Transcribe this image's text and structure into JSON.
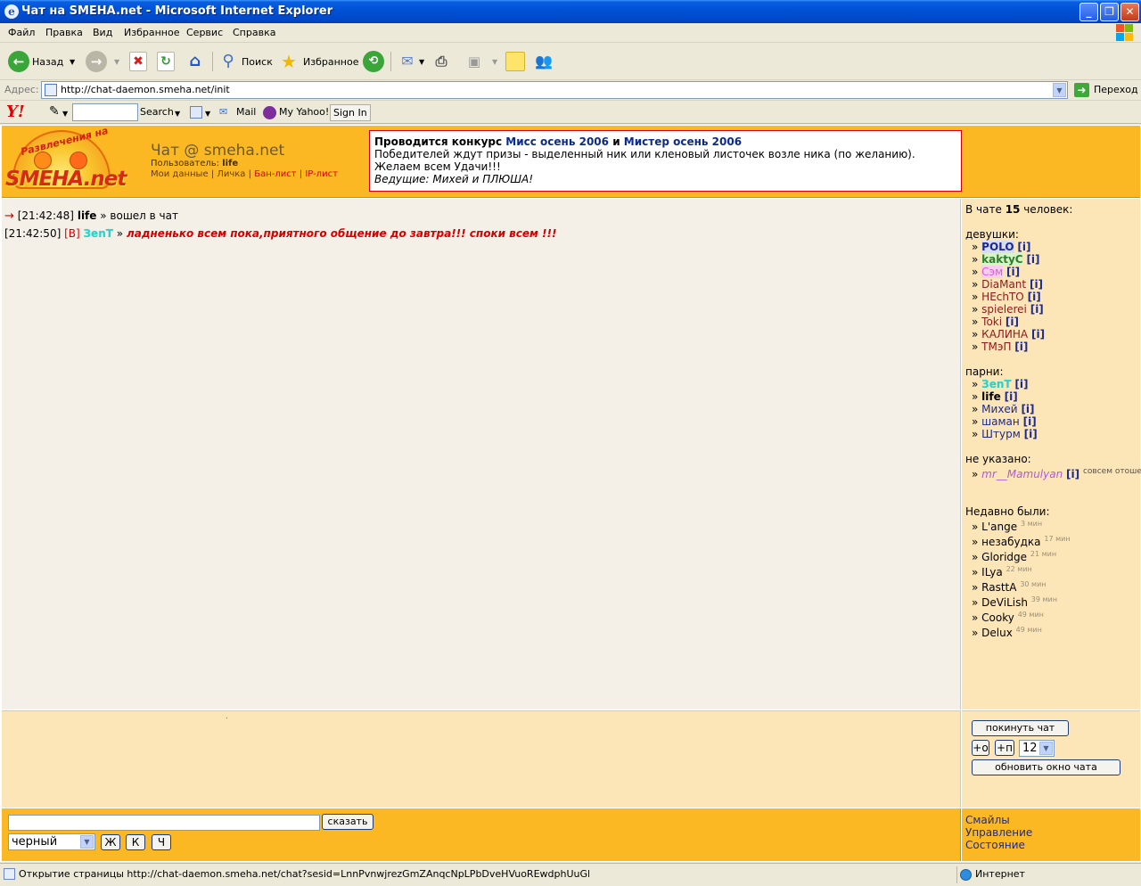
{
  "window": {
    "title": "Чат на SMEHA.net - Microsoft Internet Explorer"
  },
  "menu": [
    "Файл",
    "Правка",
    "Вид",
    "Избранное",
    "Сервис",
    "Справка"
  ],
  "toolbar": {
    "back": "Назад",
    "search": "Поиск",
    "favorites": "Избранное"
  },
  "address": {
    "label": "Адрес:",
    "url": "http://chat-daemon.smeha.net/init",
    "go": "Переход"
  },
  "yahoo": {
    "logo": "Y!",
    "search": "Search",
    "mail": "Mail",
    "my_yahoo": "My Yahoo!",
    "sign_in": "Sign In"
  },
  "header": {
    "logo_arc": "Развлечения на",
    "logo_main": "SMEHA.net",
    "chat_title": "Чат @ smeha.net",
    "user_label": "Пользователь:",
    "user_name": "life",
    "links": [
      "Мои данные",
      "Личка",
      "Бан-лист",
      "IP-лист"
    ]
  },
  "announcement": {
    "line1_a": "Проводится конкурс ",
    "line1_b": "Мисс осень 2006",
    "line1_c": " и ",
    "line1_d": "Мистер осень 2006",
    "line2": "Победителей ждут призы - выделенный ник или кленовый листочек возле ника (по желанию).",
    "line3": "Желаем всем Удачи!!!",
    "line4": "Ведущие: Михей и ПЛЮША!"
  },
  "messages": [
    {
      "arrow": "→",
      "time": "[21:42:48]",
      "nick": "life",
      "text": "» вошел в чат"
    },
    {
      "time": "[21:42:50]",
      "tag": "[В]",
      "nick": "ЗenT",
      "sep": "»",
      "text": "ладненько всем пока,приятного общение до завтра!!! споки всем !!!"
    }
  ],
  "sidebar": {
    "count_pre": "В чате ",
    "count": "15",
    "count_post": " человек:",
    "girls_label": "девушки:",
    "girls": [
      "POLO",
      "kaktyC",
      "Сэм",
      "DiaMant",
      "HEchTO",
      "spielerei",
      "Toki",
      "КАЛИНА",
      "ТМэП"
    ],
    "boys_label": "парни:",
    "boys": [
      "ЗenT",
      "life",
      "Михей",
      "шаман",
      "Штурм"
    ],
    "unspecified_label": "не указано:",
    "unspecified": [
      {
        "nick": "mr__Mamulyan",
        "status": "совсем отошел"
      }
    ],
    "info": "[i]",
    "bullet": "»",
    "recent_label": "Недавно были:",
    "recent": [
      {
        "nick": "L'ange",
        "ago": "3 мин"
      },
      {
        "nick": "незабудка",
        "ago": "17 мин"
      },
      {
        "nick": "Gloridge",
        "ago": "21 мин"
      },
      {
        "nick": "ILya",
        "ago": "22 мин"
      },
      {
        "nick": "RasttA",
        "ago": "30 мин"
      },
      {
        "nick": "DeViLish",
        "ago": "39 мин"
      },
      {
        "nick": "Cooky",
        "ago": "49 мин"
      },
      {
        "nick": "Delux",
        "ago": "49 мин"
      }
    ]
  },
  "controls": {
    "leave": "покинуть чат",
    "plus_o": "+о",
    "plus_p": "+п",
    "font_size": "12",
    "refresh": "обновить окно чата"
  },
  "composer": {
    "send": "сказать",
    "color": "черный",
    "bold": "Ж",
    "italic": "К",
    "underline": "Ч"
  },
  "footer_links": [
    "Смайлы",
    "Управление",
    "Состояние"
  ],
  "status": {
    "text": "Открытие страницы http://chat-daemon.smeha.net/chat?sesid=LnnPvnwjrezGmZAnqcNpLPbDveHVuoREwdphUuGBDMlRkZUqKP...",
    "zone": "Интернет"
  },
  "colors": {
    "header_orange": "#fcb823",
    "sidebar_cream": "#fce6b8",
    "chat_bg": "#f4f0e8",
    "alert_red": "#d40000"
  }
}
